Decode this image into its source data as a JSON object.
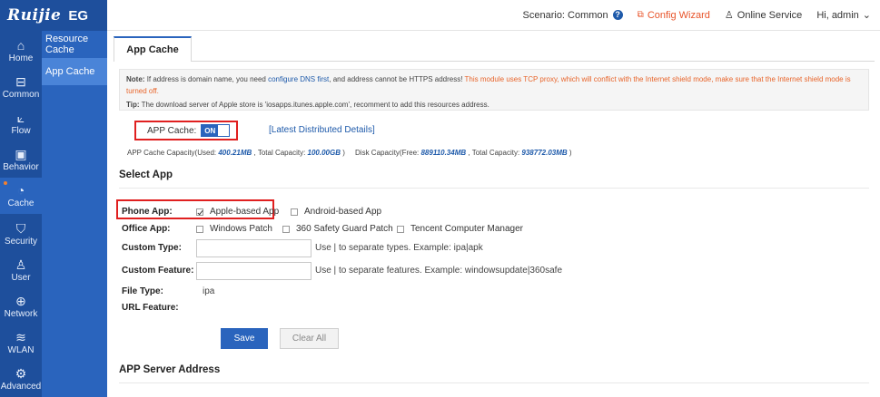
{
  "brand": {
    "logo_text": "Ruijie",
    "product": "EG"
  },
  "topbar": {
    "scenario": "Scenario:  Common",
    "config_wizard": "Config Wizard",
    "online_service": "Online Service",
    "user_greeting": "Hi, admin"
  },
  "nav": {
    "items": [
      {
        "label": "Home",
        "icon": "home-icon"
      },
      {
        "label": "Common",
        "icon": "briefcase-icon"
      },
      {
        "label": "Flow",
        "icon": "chart-icon"
      },
      {
        "label": "Behavior",
        "icon": "behavior-icon"
      },
      {
        "label": "Cache",
        "icon": "gauge-icon"
      },
      {
        "label": "Security",
        "icon": "shield-icon"
      },
      {
        "label": "User",
        "icon": "user-icon"
      },
      {
        "label": "Network",
        "icon": "globe-icon"
      },
      {
        "label": "WLAN",
        "icon": "wifi-icon"
      },
      {
        "label": "Advanced",
        "icon": "gear-icon"
      }
    ],
    "active": "Cache",
    "submenu": [
      "Resource Cache",
      "App Cache"
    ],
    "submenu_active": "App Cache"
  },
  "tab": {
    "label": "App Cache"
  },
  "note": {
    "note_label": "Note:",
    "note_text1": "If address is domain name, you need",
    "note_link": "configure DNS first",
    "note_text2": ", and address cannot be HTTPS address!",
    "note_warn": "This module uses TCP proxy, which will conflict with the Internet shield mode, make sure that the Internet shield mode is turned off.",
    "tip_label": "Tip:",
    "tip_text": "The download server of Apple store is 'iosapps.itunes.apple.com', recomment to add this resources address."
  },
  "app_cache": {
    "label": "APP Cache:",
    "toggle_state": "ON",
    "dist_link": "[Latest Distributed Details]"
  },
  "capacity": {
    "part1": "APP Cache Capacity(Used:",
    "used": "400.21MB",
    "part2": ", Total Capacity:",
    "total": "100.00GB",
    "part3": ")     Disk Capacity(Free:",
    "disk_free": "889110.34MB",
    "part4": ", Total Capacity:",
    "disk_total": "938772.03MB",
    "part5": ")"
  },
  "select_app": {
    "title": "Select App",
    "phone_label": "Phone App:",
    "phone_opts": [
      "Apple-based App",
      "Android-based App"
    ],
    "office_label": "Office App:",
    "office_opts": [
      "Windows Patch",
      "360 Safety Guard Patch",
      "Tencent Computer Manager"
    ],
    "custom_type_label": "Custom Type:",
    "custom_type_value": "",
    "custom_type_hint": "Use | to separate types. Example: ipa|apk",
    "custom_feature_label": "Custom Feature:",
    "custom_feature_value": "",
    "custom_feature_hint": "Use | to separate features. Example: windowsupdate|360safe",
    "file_type_label": "File Type:",
    "file_type_value": "ipa",
    "url_feature_label": "URL Feature:"
  },
  "buttons": {
    "save": "Save",
    "clear": "Clear All"
  },
  "server_section": {
    "title": "APP Server Address"
  }
}
